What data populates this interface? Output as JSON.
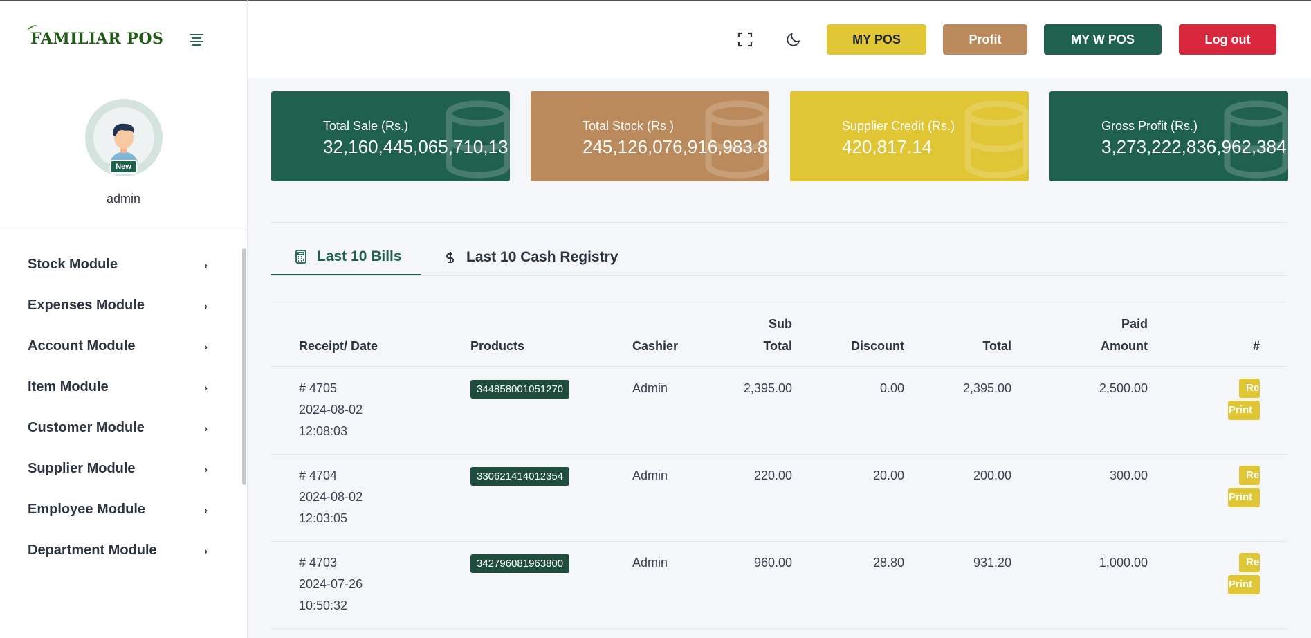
{
  "brand": {
    "name": "FAMILIAR POS"
  },
  "profile": {
    "name": "admin",
    "badge": "New"
  },
  "sidebar": {
    "items": [
      {
        "label": "Stock Module",
        "chevron": "›"
      },
      {
        "label": "Expenses Module",
        "chevron": "›"
      },
      {
        "label": "Account Module",
        "chevron": "›"
      },
      {
        "label": "Item Module",
        "chevron": "›"
      },
      {
        "label": "Customer Module",
        "chevron": "›"
      },
      {
        "label": "Supplier Module",
        "chevron": "›"
      },
      {
        "label": "Employee Module",
        "chevron": "›"
      },
      {
        "label": "Department Module",
        "chevron": "›"
      }
    ]
  },
  "topbar": {
    "buttons": {
      "my_pos": "MY POS",
      "profit": "Profit",
      "my_w_pos": "MY W POS",
      "logout": "Log out"
    },
    "icons": [
      "fullscreen-icon",
      "moon-icon"
    ]
  },
  "stats": [
    {
      "label": "Total Sale (Rs.)",
      "value": "32,160,445,065,710,13",
      "color": "#20604e"
    },
    {
      "label": "Total Stock (Rs.)",
      "value": "245,126,076,916,983.8",
      "color": "#bb8a5c"
    },
    {
      "label": "Supplier Credit (Rs.)",
      "value": "420,817.14",
      "color": "#e0c535"
    },
    {
      "label": "Gross Profit (Rs.)",
      "value": "3,273,222,836,962,384",
      "color": "#20604e"
    }
  ],
  "tabs": [
    {
      "label": "Last 10 Bills",
      "active": true
    },
    {
      "label": "Last 10 Cash Registry",
      "active": false
    }
  ],
  "table": {
    "headers": {
      "receipt": "Receipt/ Date",
      "products": "Products",
      "cashier": "Cashier",
      "sub_total_1": "Sub",
      "sub_total_2": "Total",
      "discount": "Discount",
      "total": "Total",
      "paid_1": "Paid",
      "paid_2": "Amount",
      "hash": "#"
    },
    "rows": [
      {
        "receipt": "# 4705",
        "date": "2024-08-02",
        "time": "12:08:03",
        "product": "344858001051270",
        "cashier": "Admin",
        "sub_total": "2,395.00",
        "discount": "0.00",
        "total": "2,395.00",
        "paid": "2,500.00",
        "action1": "Re",
        "action2": "Print"
      },
      {
        "receipt": "# 4704",
        "date": "2024-08-02",
        "time": "12:03:05",
        "product": "330621414012354",
        "cashier": "Admin",
        "sub_total": "220.00",
        "discount": "20.00",
        "total": "200.00",
        "paid": "300.00",
        "action1": "Re",
        "action2": "Print"
      },
      {
        "receipt": "# 4703",
        "date": "2024-07-26",
        "time": "10:50:32",
        "product": "342796081963800",
        "cashier": "Admin",
        "sub_total": "960.00",
        "discount": "28.80",
        "total": "931.20",
        "paid": "1,000.00",
        "action1": "Re",
        "action2": "Print"
      }
    ]
  },
  "colors": {
    "primary": "#20604e",
    "brown": "#bb8a5c",
    "yellow": "#e0c535",
    "danger": "#d9273d"
  }
}
